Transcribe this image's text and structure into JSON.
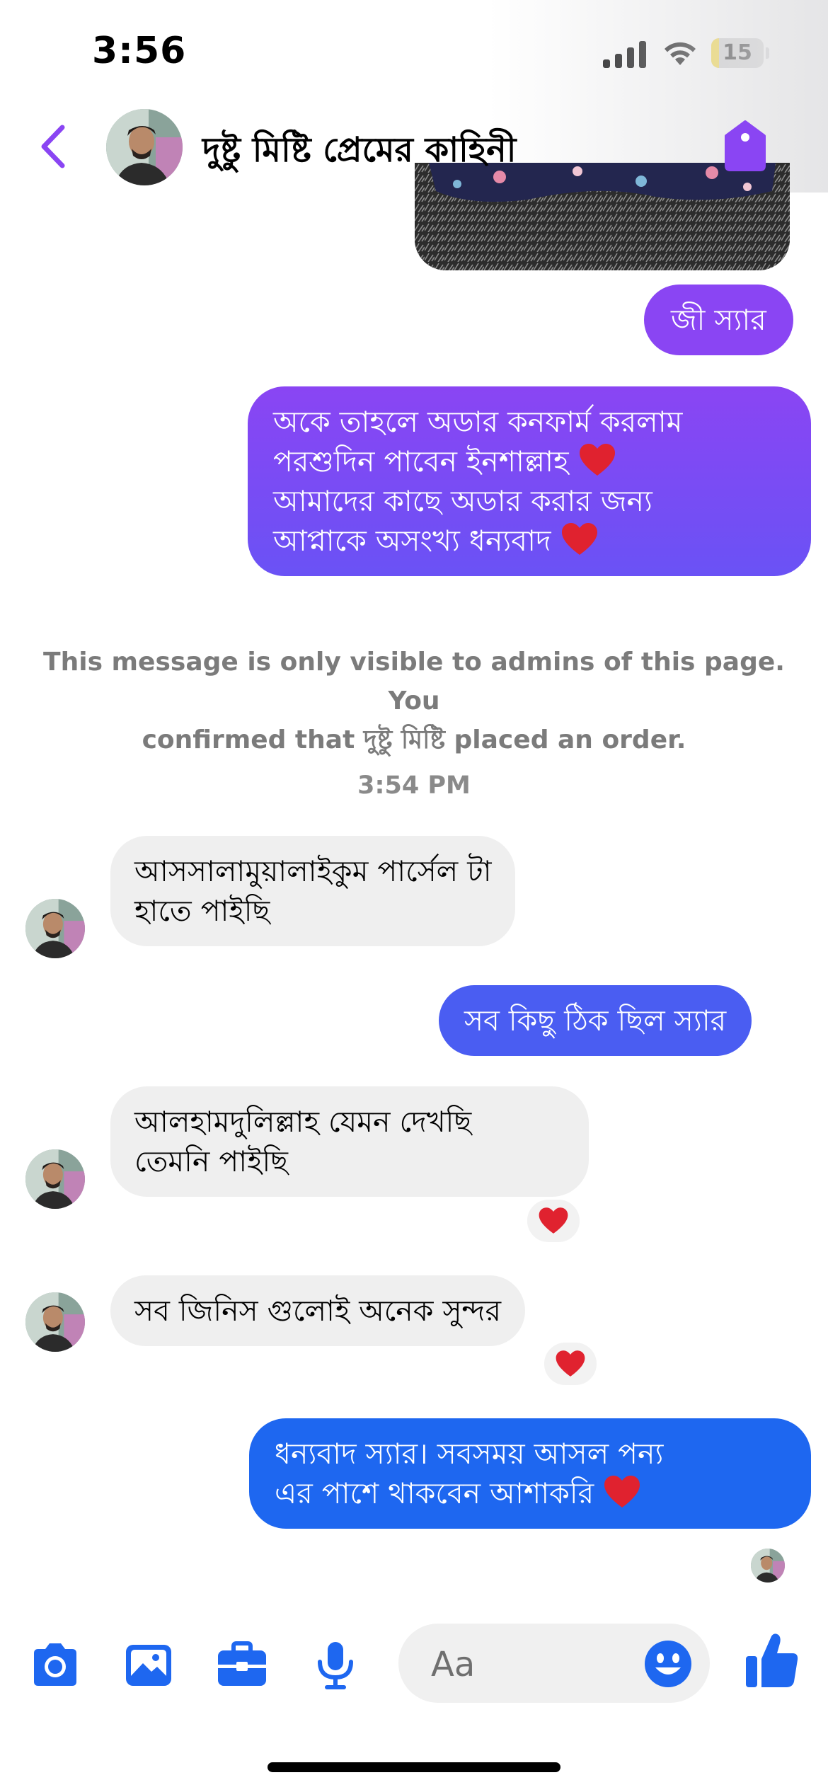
{
  "status_bar": {
    "time": "3:56",
    "battery": "15",
    "battery_level": 0.15
  },
  "header": {
    "back_icon": "chevron-left-icon",
    "title": "দুষ্টু মিষ্টি প্রেমের কাহিনী",
    "action_icon": "tag-icon"
  },
  "messages": [
    {
      "text": "জী স্যার"
    },
    {
      "text": "অকে তাহলে অডার কনফার্ম করলাম\nপরশুদিন পাবেন ইনশাল্লাহ ",
      "text2": "\nআমাদের কাছে অডার করার জন্য\nআপ্নাকে অসংখ্য ধন্যবাদ "
    },
    {
      "text": "আসসালামুয়ালাইকুম পার্সেল টা\nহাতে পাইছি"
    },
    {
      "text": "সব কিছু ঠিক ছিল স্যার"
    },
    {
      "text": "আলহামদুলিল্লাহ যেমন দেখছি\nতেমনি পাইছি",
      "reaction": "heart"
    },
    {
      "text": "সব জিনিস গুলোই অনেক সুন্দর",
      "reaction": "heart"
    },
    {
      "text": "ধন্যবাদ স্যার।  সবসময় আসল পন্য\nএর পাশে থাকবেন আশাকরি "
    }
  ],
  "system_note": "This message is only visible to admins of this page. You\nconfirmed that দুষ্টু মিষ্টি placed an order.",
  "timestamp": "3:54 PM",
  "composer": {
    "icons": [
      "camera-icon",
      "gallery-icon",
      "briefcase-icon",
      "microphone-icon",
      "emoji-icon",
      "thumbs-up-icon"
    ],
    "placeholder": "Aa"
  },
  "colors": {
    "accent_purple": "#8a45f3",
    "accent_blue": "#1e67f0",
    "incoming_bubble": "#efefef",
    "reaction_heart": "#e0222f"
  }
}
